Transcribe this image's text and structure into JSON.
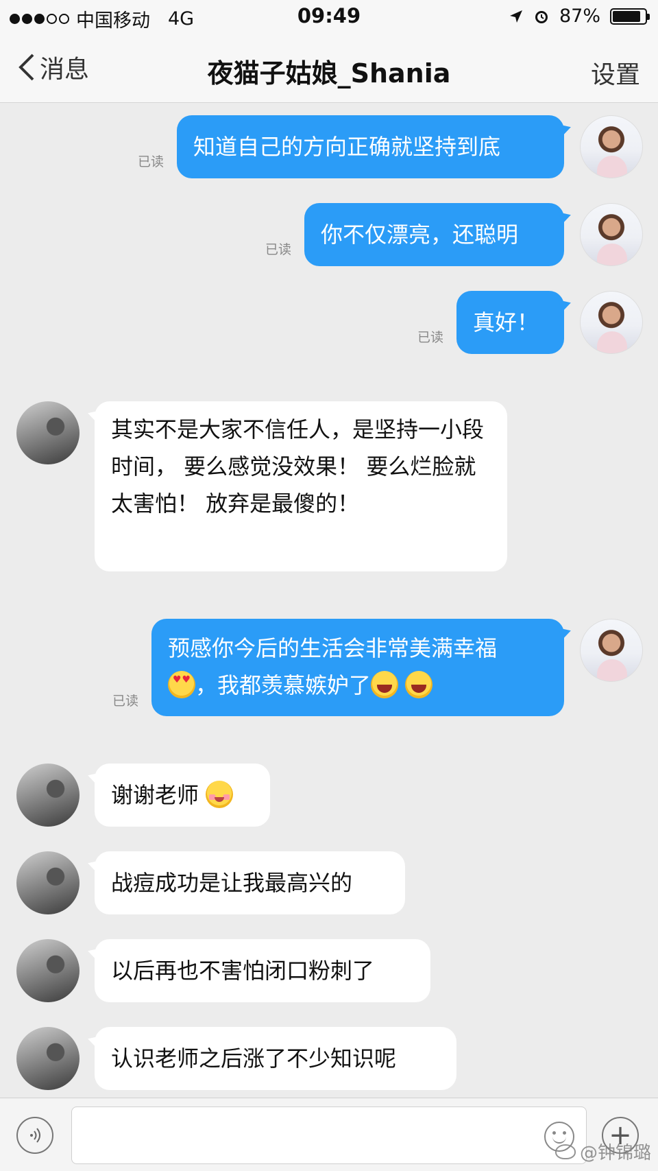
{
  "status_bar": {
    "carrier": "中国移动",
    "network": "4G",
    "time": "09:49",
    "battery": "87%",
    "battery_level": 0.87
  },
  "nav": {
    "back_label": "消息",
    "title": "夜猫子姑娘_Shania",
    "settings_label": "设置"
  },
  "read_label": "已读",
  "messages": [
    {
      "from": "me",
      "text": "知道自己的方向正确就坚持到底"
    },
    {
      "from": "me",
      "text": "你不仅漂亮，还聪明"
    },
    {
      "from": "me",
      "text": "真好！"
    },
    {
      "from": "them",
      "text": "其实不是大家不信任人，是坚持一小段时间， 要么感觉没效果！ 要么烂脸就太害怕！ 放弃是最傻的！"
    },
    {
      "from": "me",
      "text_line1": "预感你今后的生活会非常美满幸福",
      "text_line2": "，我都羡慕嫉妒了",
      "emojis": [
        "heart-eyes-emoji",
        "grin-emoji",
        "grin-emoji"
      ]
    },
    {
      "from": "them",
      "text": "谢谢老师",
      "emojis": [
        "blush-emoji"
      ]
    },
    {
      "from": "them",
      "text": "战痘成功是让我最高兴的"
    },
    {
      "from": "them",
      "text": "以后再也不害怕闭口粉刺了"
    },
    {
      "from": "them",
      "text": "认识老师之后涨了不少知识呢"
    }
  ],
  "input": {
    "value": ""
  },
  "watermark": "@钟锦璐",
  "colors": {
    "outgoing_bubble": "#2b9cf7",
    "incoming_bubble": "#ffffff",
    "background": "#ececec"
  }
}
